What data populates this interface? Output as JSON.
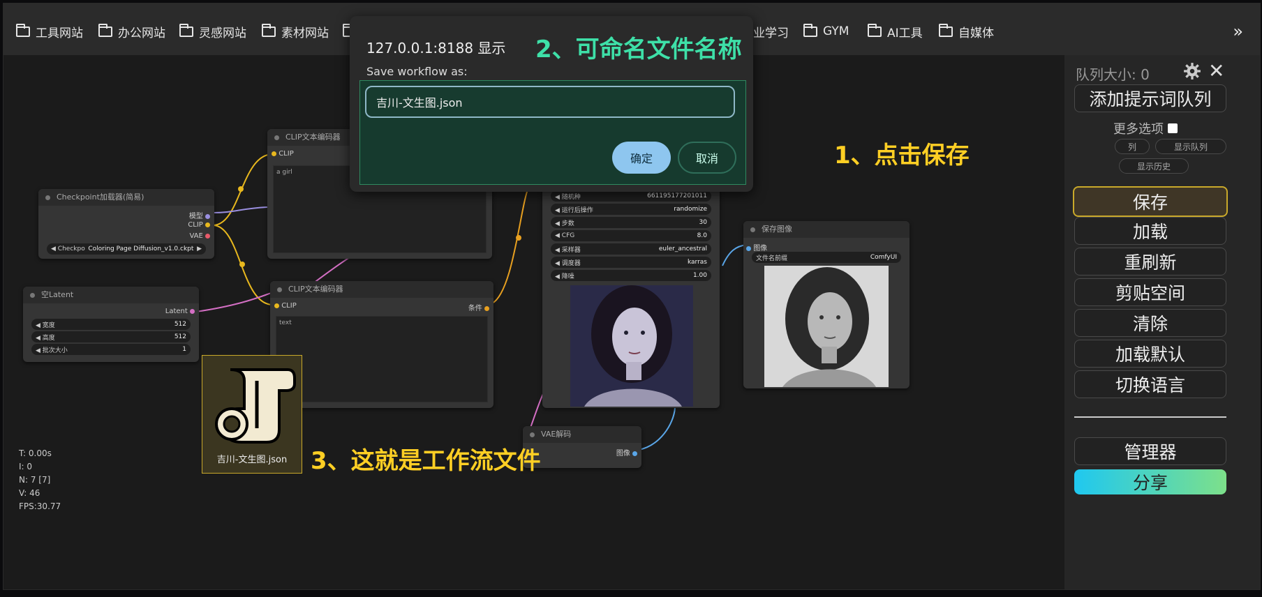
{
  "bookmarks": {
    "items": [
      "工具网站",
      "办公网站",
      "灵感网站",
      "素材网站",
      "业学习",
      "GYM",
      "AI工具",
      "自媒体"
    ],
    "more": "»"
  },
  "nodes": {
    "clip_top": {
      "title": "CLIP文本编码器",
      "input": "CLIP",
      "text": "a girl"
    },
    "checkpoint": {
      "title": "Checkpoint加载器(简易)",
      "out_model": "模型",
      "out_clip": "CLIP",
      "out_vae": "VAE",
      "widget_label": "Checkpo",
      "widget_value": "Coloring Page Diffusion_v1.0.ckpt"
    },
    "latent": {
      "title": "空Latent",
      "output": "Latent",
      "w_width_label": "宽度",
      "w_width": "512",
      "w_height_label": "高度",
      "w_height": "512",
      "w_batch_label": "批次大小",
      "w_batch": "1"
    },
    "clip_bottom": {
      "title": "CLIP文本编码器",
      "input": "CLIP",
      "output": "条件",
      "text": "text"
    },
    "ksampler": {
      "widgets": [
        {
          "label": "随机种",
          "value": "661195177201011"
        },
        {
          "label": "运行后操作",
          "value": "randomize"
        },
        {
          "label": "步数",
          "value": "30"
        },
        {
          "label": "CFG",
          "value": "8.0"
        },
        {
          "label": "采样器",
          "value": "euler_ancestral"
        },
        {
          "label": "调度器",
          "value": "karras"
        },
        {
          "label": "降噪",
          "value": "1.00"
        }
      ]
    },
    "save_image": {
      "title": "保存图像",
      "input": "图像",
      "prefix_label": "文件名前缀",
      "prefix_value": "ComfyUI"
    },
    "vae_decode": {
      "title": "VAE解码",
      "output": "图像"
    }
  },
  "stats": [
    "T: 0.00s",
    "I: 0",
    "N: 7 [7]",
    "V: 46",
    "FPS:30.77"
  ],
  "menu": {
    "queue_size": "队列大小: 0",
    "queue_prompt": "添加提示词队列",
    "more_options": "更多选项",
    "view_queue_partial": "列",
    "view_queue": "显示队列",
    "view_history": "显示历史",
    "save": "保存",
    "load": "加载",
    "refresh": "重刷新",
    "clipspace": "剪贴空间",
    "clear": "清除",
    "load_default": "加载默认",
    "switch_lang": "切换语言",
    "manager": "管理器",
    "share": "分享"
  },
  "dialog": {
    "title": "127.0.0.1:8188 显示",
    "label": "Save workflow as:",
    "value": "吉川-文生图.json",
    "ok": "确定",
    "cancel": "取消"
  },
  "annotations": {
    "step1": "1、点击保存",
    "step2": "2、可命名文件名称",
    "step3": "3、这就是工作流文件"
  },
  "file": {
    "name": "吉川-文生图.json"
  },
  "colors": {
    "accent_yellow": "#ffcf24",
    "accent_green": "#3ee0a8",
    "share_gradient_start": "#1fc8f0",
    "share_gradient_end": "#7de08a"
  }
}
